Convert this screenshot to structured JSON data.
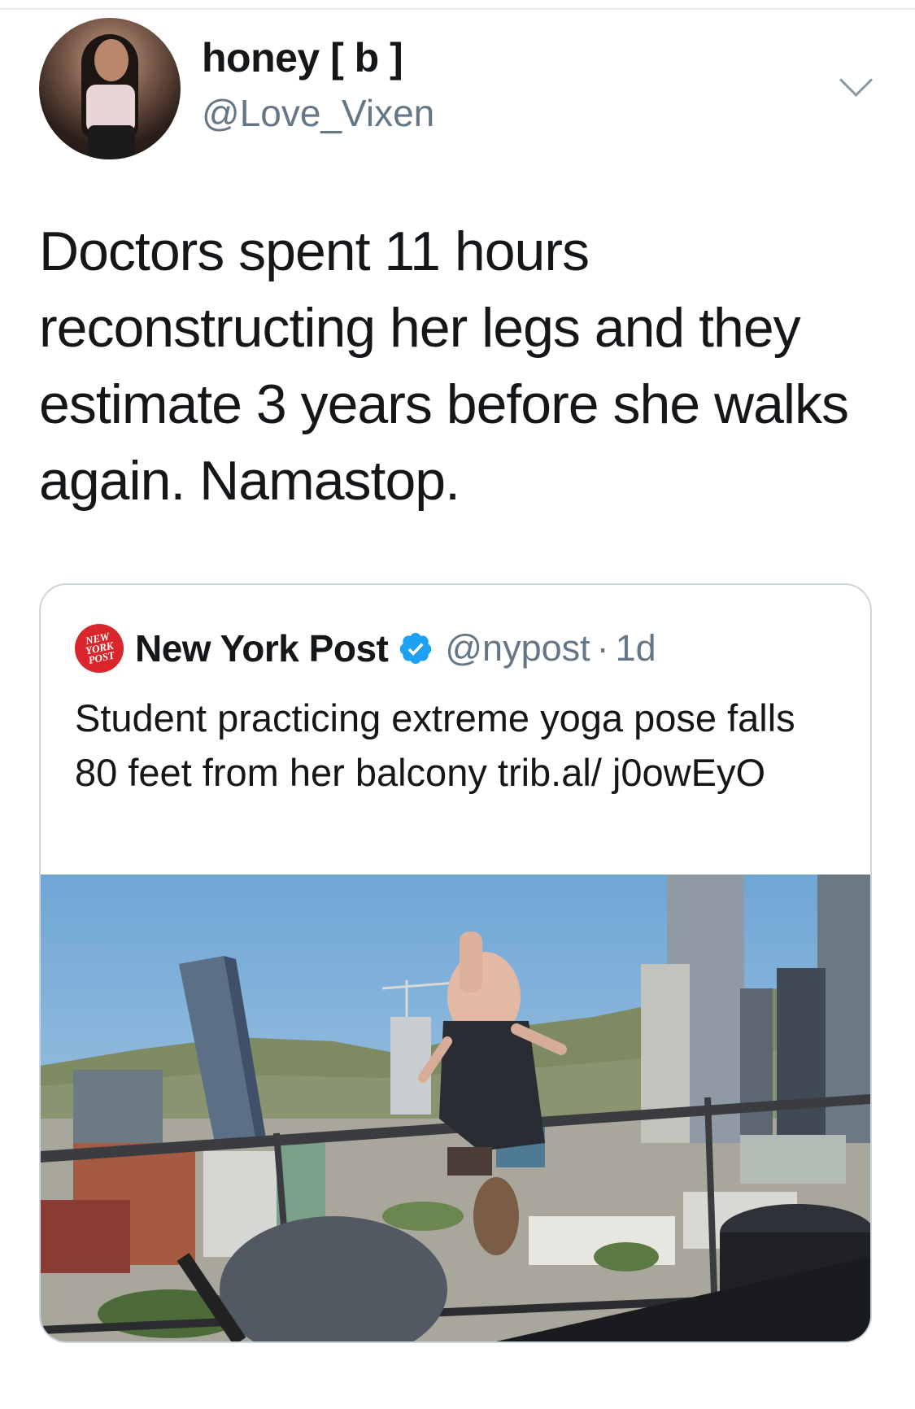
{
  "tweet": {
    "display_name": "honey [ b ]",
    "handle": "@Love_Vixen",
    "text": "Doctors spent 11 hours reconstructing her legs and they estimate 3 years before she walks again. Namastop."
  },
  "quoted_tweet": {
    "display_name": "New York Post",
    "handle": "@nypost",
    "separator": "·",
    "time": "1d",
    "text": "Student practicing extreme yoga pose falls 80 feet from her balcony trib.al/ j0owEyO",
    "logo_text": "NEW YORK POST"
  },
  "icons": {
    "menu": "chevron-down-icon",
    "verified": "verified-badge-icon"
  },
  "colors": {
    "secondary_text": "#657786",
    "verified_blue": "#1da1f2",
    "nypost_red": "#d9262c",
    "card_border": "#ccd6dd"
  }
}
